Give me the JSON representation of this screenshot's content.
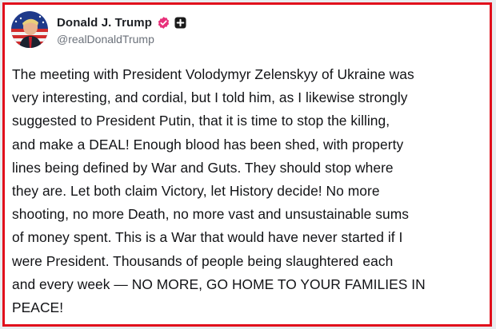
{
  "post": {
    "author": {
      "display_name": "Donald J. Trump",
      "handle": "@realDonaldTrump",
      "avatar_icon": "flag-portrait-avatar",
      "verified_icon": "verified-badge-icon",
      "extra_badge_icon": "plus-badge-icon"
    },
    "body": "The meeting with President Volodymyr Zelenskyy of Ukraine was\nvery interesting, and cordial, but I told him, as I likewise strongly\nsuggested to President Putin, that it is time to stop the killing,\nand make a DEAL! Enough blood has been shed, with property\nlines being defined by War and Guts. They should stop where\nthey are. Let both claim Victory, let History decide! No more\nshooting, no more Death, no more vast and unsustainable sums\nof money spent. This is a War that would have never started if I\nwere President. Thousands of people being slaughtered each\nand every week — NO MORE, GO HOME TO YOUR FAMILIES IN\nPEACE!"
  },
  "colors": {
    "highlight_border": "#e10f1c",
    "verified_badge": "#e8307a",
    "text": "#121316",
    "handle": "#6b717a"
  }
}
